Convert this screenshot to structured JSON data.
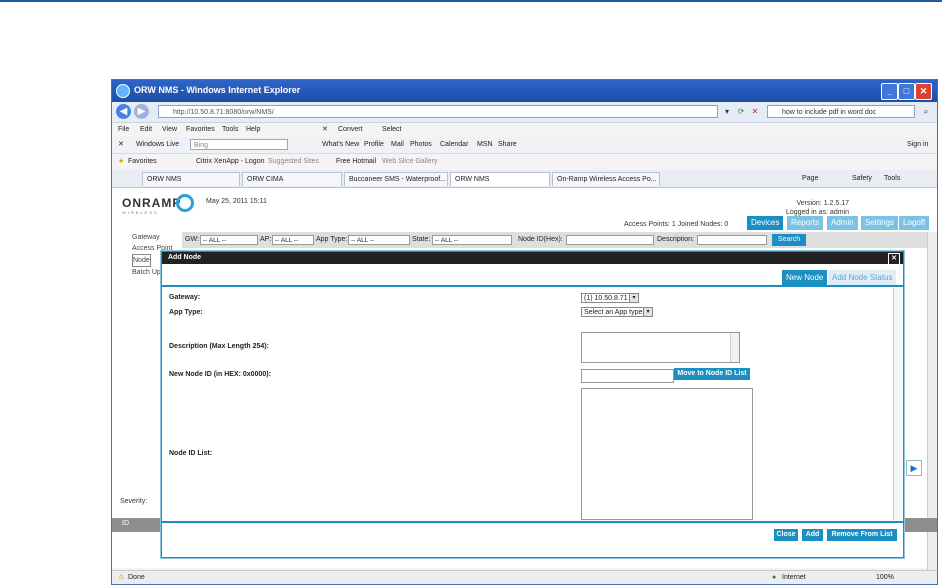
{
  "browser": {
    "title": "ORW NMS - Windows Internet Explorer",
    "address": "http://10.50.8.71:8080/orw/NMS/",
    "search_value": "how to include pdf in word doc",
    "menu": [
      "File",
      "Edit",
      "View",
      "Favorites",
      "Tools",
      "Help"
    ],
    "convert_label": "Convert",
    "select_label": "Select",
    "live_label": "Windows Live",
    "bing_value": "Bing",
    "live_links": [
      "What's New",
      "Profile",
      "Mail",
      "Photos",
      "Calendar",
      "MSN",
      "Share"
    ],
    "sign_in": "Sign in",
    "favorites_label": "Favorites",
    "favorite_links": [
      "Citrix XenApp - Logon",
      "Suggested Sites",
      "Free Hotmail",
      "Web Slice Gallery"
    ],
    "tabs": [
      "ORW NMS",
      "ORW CIMA",
      "Buccaneer SMS - Waterproof...",
      "ORW NMS",
      "On-Ramp Wireless Access Po..."
    ],
    "tools": [
      "Page",
      "Safety",
      "Tools"
    ],
    "status_done": "Done",
    "status_zone": "Internet",
    "zoom": "100%"
  },
  "app": {
    "logo": "ONRAMP",
    "logo_sub": "WIRELESS",
    "date": "May 25, 2011 15:11",
    "version": "Version: 1.2.5.17",
    "logged_in": "Logged in as: admin",
    "counts": "Access Points: 1 Joined Nodes: 0",
    "nav_tabs": [
      "Devices",
      "Reports",
      "Admin",
      "Settings",
      "Logoff"
    ],
    "left_nav": [
      "Gateway",
      "Access Point",
      "Node",
      "Batch Up"
    ],
    "filter": {
      "gw_label": "GW:",
      "gw_value": "-- ALL --",
      "ap_label": "AP:",
      "ap_value": "-- ALL --",
      "apptype_label": "App Type:",
      "apptype_value": "-- ALL --",
      "state_label": "State:",
      "state_value": "-- ALL --",
      "nodeid_label": "Node ID(Hex):",
      "description_label": "Description:",
      "search_label": "Search"
    },
    "severity_label": "Severity:",
    "id_header": "ID"
  },
  "modal": {
    "title": "Add Node",
    "tabs": [
      "New Node",
      "Add Node Status"
    ],
    "gateway_label": "Gateway:",
    "gateway_value": "(1) 10.50.8.71",
    "apptype_label": "App Type:",
    "apptype_value": "Select an App type",
    "description_label": "Description (Max Length 254):",
    "nodeid_label": "New Node ID (in HEX: 0x0000):",
    "move_label": "Move to Node ID List",
    "list_label": "Node ID List:",
    "buttons": [
      "Close",
      "Add",
      "Remove From List"
    ]
  },
  "colors": {
    "accent": "#1b8ec2",
    "titlebar": "#1d4fa6"
  }
}
